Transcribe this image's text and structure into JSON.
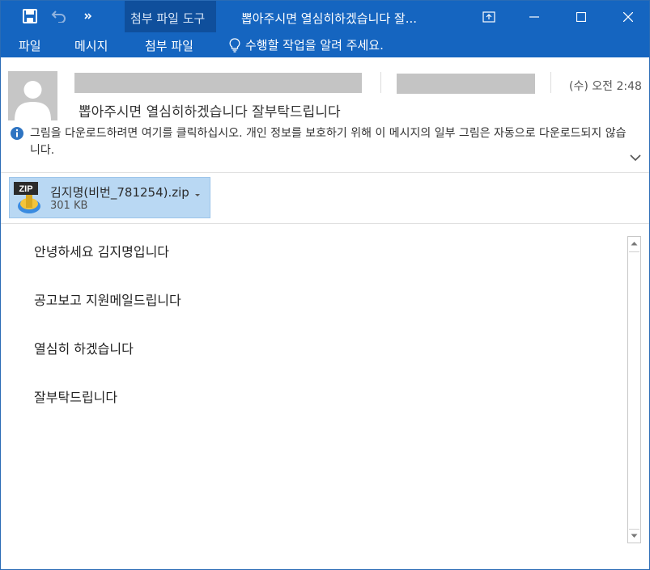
{
  "colors": {
    "titlebar": "#1565c0",
    "context_tab": "#0f4f9c",
    "attachment_bg": "#b9d8f3",
    "info_icon": "#2e74c2"
  },
  "quick_access": {
    "save_icon": "save-icon",
    "undo_icon": "undo-icon",
    "customize_icon": "customize-qat-icon"
  },
  "titlebar": {
    "context_group": "첨부 파일 도구",
    "window_title": "뽑아주시면 열심히하겠습니다 잘..."
  },
  "window_controls": [
    "ribbon-display-icon",
    "minimize-icon",
    "maximize-icon",
    "close-icon"
  ],
  "ribbon": {
    "tabs": [
      {
        "label": "파일"
      },
      {
        "label": "메시지"
      },
      {
        "label": "첨부 파일"
      }
    ],
    "tell_me": "수행할 작업을 알려 주세요."
  },
  "message": {
    "time": "(수) 오전 2:48",
    "subject": "뽑아주시면 열심히하겠습니다 잘부탁드립니다",
    "info_bar": "그림을 다운로드하려면 여기를 클릭하십시오. 개인 정보를 보호하기 위해 이 메시지의 일부 그림은 자동으로 다운로드되지 않습니다."
  },
  "attachment": {
    "icon_label": "ZIP",
    "name": "김지명(비번_781254).zip",
    "size": "301 KB"
  },
  "body": {
    "lines": [
      "안녕하세요 김지명입니다",
      "공고보고 지원메일드립니다",
      "열심히 하겠습니다",
      "잘부탁드립니다"
    ]
  }
}
